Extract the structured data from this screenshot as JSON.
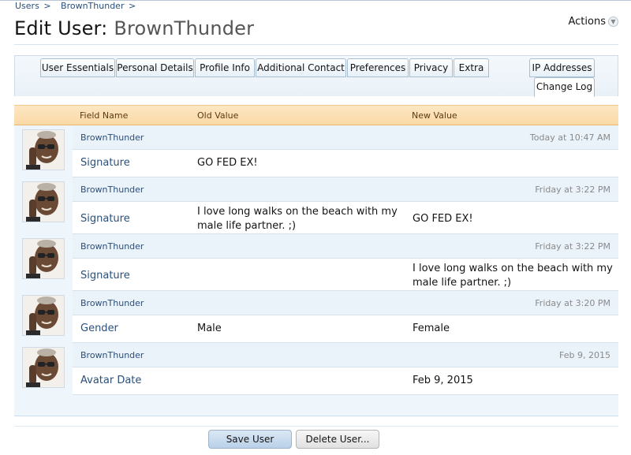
{
  "breadcrumb": {
    "items": [
      "Users",
      "BrownThunder"
    ],
    "separator": ">"
  },
  "title": {
    "prefix": "Edit User:",
    "username": "BrownThunder"
  },
  "actions": {
    "label": "Actions",
    "icon": "chevron-down-icon"
  },
  "tabs": {
    "left": [
      "User Essentials",
      "Personal Details",
      "Profile Info",
      "Additional Contact",
      "Preferences",
      "Privacy",
      "Extra"
    ],
    "ip": "IP Addresses",
    "change_log": "Change Log",
    "active": "Change Log"
  },
  "table": {
    "headers": {
      "field": "Field Name",
      "old": "Old Value",
      "new": "New Value"
    },
    "entries": [
      {
        "user": "BrownThunder",
        "time": "Today at 10:47 AM",
        "field": "Signature",
        "old": "GO FED EX!",
        "new": ""
      },
      {
        "user": "BrownThunder",
        "time": "Friday at 3:22 PM",
        "field": "Signature",
        "old": "I love long walks on the beach with my male life partner. ;)",
        "new": "GO FED EX!"
      },
      {
        "user": "BrownThunder",
        "time": "Friday at 3:22 PM",
        "field": "Signature",
        "old": "",
        "new": "I love long walks on the beach with my male life partner. ;)"
      },
      {
        "user": "BrownThunder",
        "time": "Friday at 3:20 PM",
        "field": "Gender",
        "old": "Male",
        "new": "Female"
      },
      {
        "user": "BrownThunder",
        "time": "Feb 9, 2015",
        "field": "Avatar Date",
        "old": "",
        "new": "Feb 9, 2015"
      }
    ]
  },
  "buttons": {
    "save": "Save User",
    "delete": "Delete User..."
  },
  "colors": {
    "accent": "#2b4f7a",
    "header_orange": "#fbd9a6",
    "panel_blue": "#eef5fb"
  }
}
